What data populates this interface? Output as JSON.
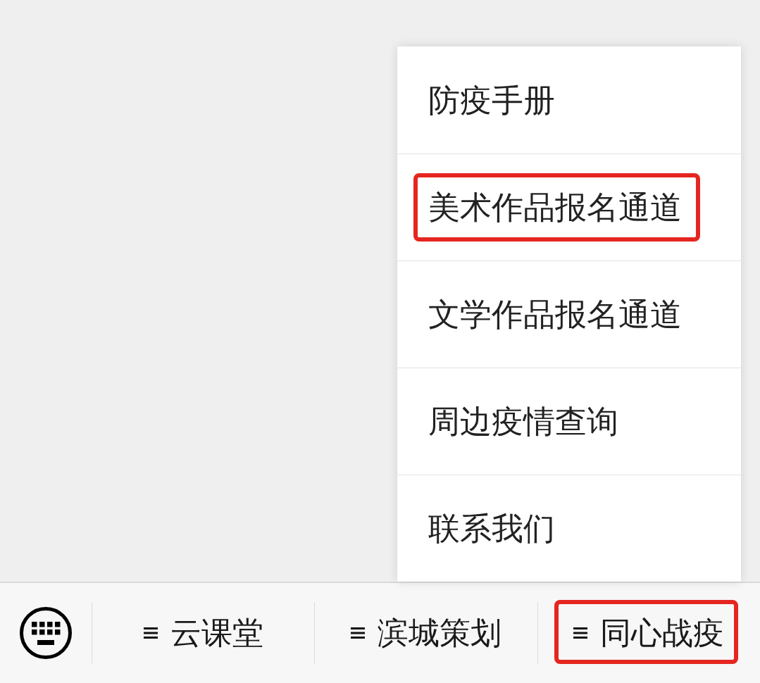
{
  "menu_popup": {
    "items": [
      {
        "label": "防疫手册",
        "highlighted": false
      },
      {
        "label": "美术作品报名通道",
        "highlighted": true
      },
      {
        "label": "文学作品报名通道",
        "highlighted": false
      },
      {
        "label": "周边疫情查询",
        "highlighted": false
      },
      {
        "label": "联系我们",
        "highlighted": false
      }
    ]
  },
  "bottom_bar": {
    "menus": [
      {
        "label": "云课堂",
        "highlighted": false
      },
      {
        "label": "滨城策划",
        "highlighted": false
      },
      {
        "label": "同心战疫",
        "highlighted": true
      }
    ]
  }
}
